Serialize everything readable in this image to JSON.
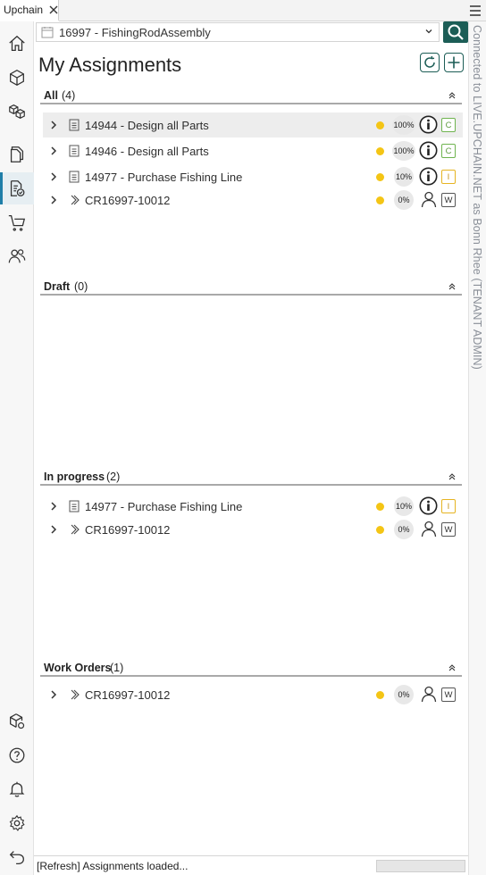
{
  "app": {
    "tab_title": "Upchain"
  },
  "connection": {
    "status_text": "Connected to LIVE.UPCHAIN.NET as Bonn Rhee (TENANT ADMIN)"
  },
  "project_selector": {
    "value": "16997 - FishingRodAssembly"
  },
  "page": {
    "title": "My Assignments"
  },
  "nav": {
    "items": [
      {
        "name": "home-icon"
      },
      {
        "name": "cube-icon"
      },
      {
        "name": "assembly-icon"
      },
      {
        "name": "documents-icon"
      },
      {
        "name": "assignments-icon",
        "active": true
      },
      {
        "name": "cart-icon"
      },
      {
        "name": "people-icon"
      }
    ],
    "bottom": [
      {
        "name": "box-settings-icon"
      },
      {
        "name": "help-icon"
      },
      {
        "name": "bell-icon"
      },
      {
        "name": "gear-icon"
      },
      {
        "name": "back-icon"
      }
    ]
  },
  "sections": {
    "all": {
      "name": "All",
      "count": "(4)",
      "rows": [
        {
          "label": "14944 - Design all Parts",
          "percent": "100%",
          "badge": "C"
        },
        {
          "label": "14946 - Design all Parts",
          "percent": "100%",
          "badge": "C"
        },
        {
          "label": "14977 - Purchase Fishing Line",
          "percent": "10%",
          "badge": "I"
        },
        {
          "label": "CR16997-10012",
          "percent": "0%",
          "badge": "W"
        }
      ]
    },
    "draft": {
      "name": "Draft",
      "count": "(0)"
    },
    "in_progress": {
      "name": "In progress",
      "count": "(2)",
      "rows": [
        {
          "label": "14977 - Purchase Fishing Line",
          "percent": "10%",
          "badge": "I"
        },
        {
          "label": "CR16997-10012",
          "percent": "0%",
          "badge": "W"
        }
      ]
    },
    "work_orders": {
      "name": "Work Orders",
      "count": "(1)",
      "rows": [
        {
          "label": "CR16997-10012",
          "percent": "0%",
          "badge": "W"
        }
      ]
    }
  },
  "colors": {
    "accent": "#1c5d56",
    "status_dot": "#f4c515",
    "complete": "#6fb44f",
    "in_progress": "#e6b422"
  },
  "status_bar": {
    "text": "[Refresh] Assignments loaded..."
  }
}
